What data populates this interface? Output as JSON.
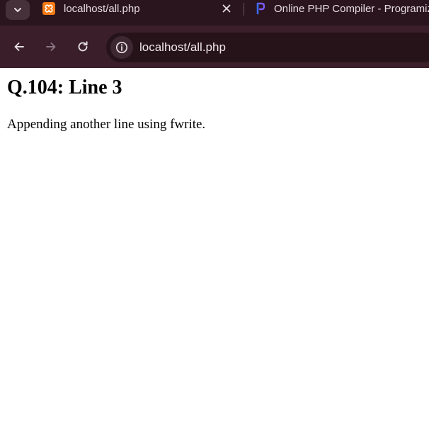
{
  "browser": {
    "tabs": [
      {
        "title": "localhost/all.php",
        "favicon": "xampp-icon",
        "active": true
      },
      {
        "title": "Online PHP Compiler - Programiz",
        "favicon": "programiz-icon",
        "active": false
      }
    ],
    "address_bar": {
      "url": "localhost/all.php"
    },
    "colors": {
      "tab_strip": "#2a141d",
      "toolbar": "#3a1f2a",
      "omnibox": "#261219",
      "xampp_orange": "#f57a14"
    }
  },
  "page": {
    "heading": "Q.104: Line 3",
    "paragraph": "Appending another line using fwrite."
  }
}
